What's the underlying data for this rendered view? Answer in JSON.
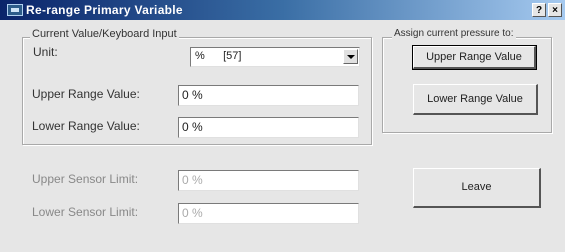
{
  "window": {
    "title": "Re-range Primary Variable",
    "help_button": "?",
    "close_button": "×"
  },
  "current_value_group": {
    "legend": "Current Value/Keyboard Input",
    "unit_label": "Unit:",
    "unit_value": "%      [57]",
    "upper_range_label": "Upper Range Value:",
    "upper_range_value": "0 %",
    "lower_range_label": "Lower Range Value:",
    "lower_range_value": "0 %"
  },
  "assign_group": {
    "legend": "Assign current pressure to:",
    "upper_button": "Upper Range Value",
    "lower_button": "Lower Range Value"
  },
  "sensor_limits": {
    "upper_label": "Upper Sensor Limit:",
    "upper_value": "0 %",
    "lower_label": "Lower Sensor Limit:",
    "lower_value": "0 %"
  },
  "leave_button": "Leave"
}
